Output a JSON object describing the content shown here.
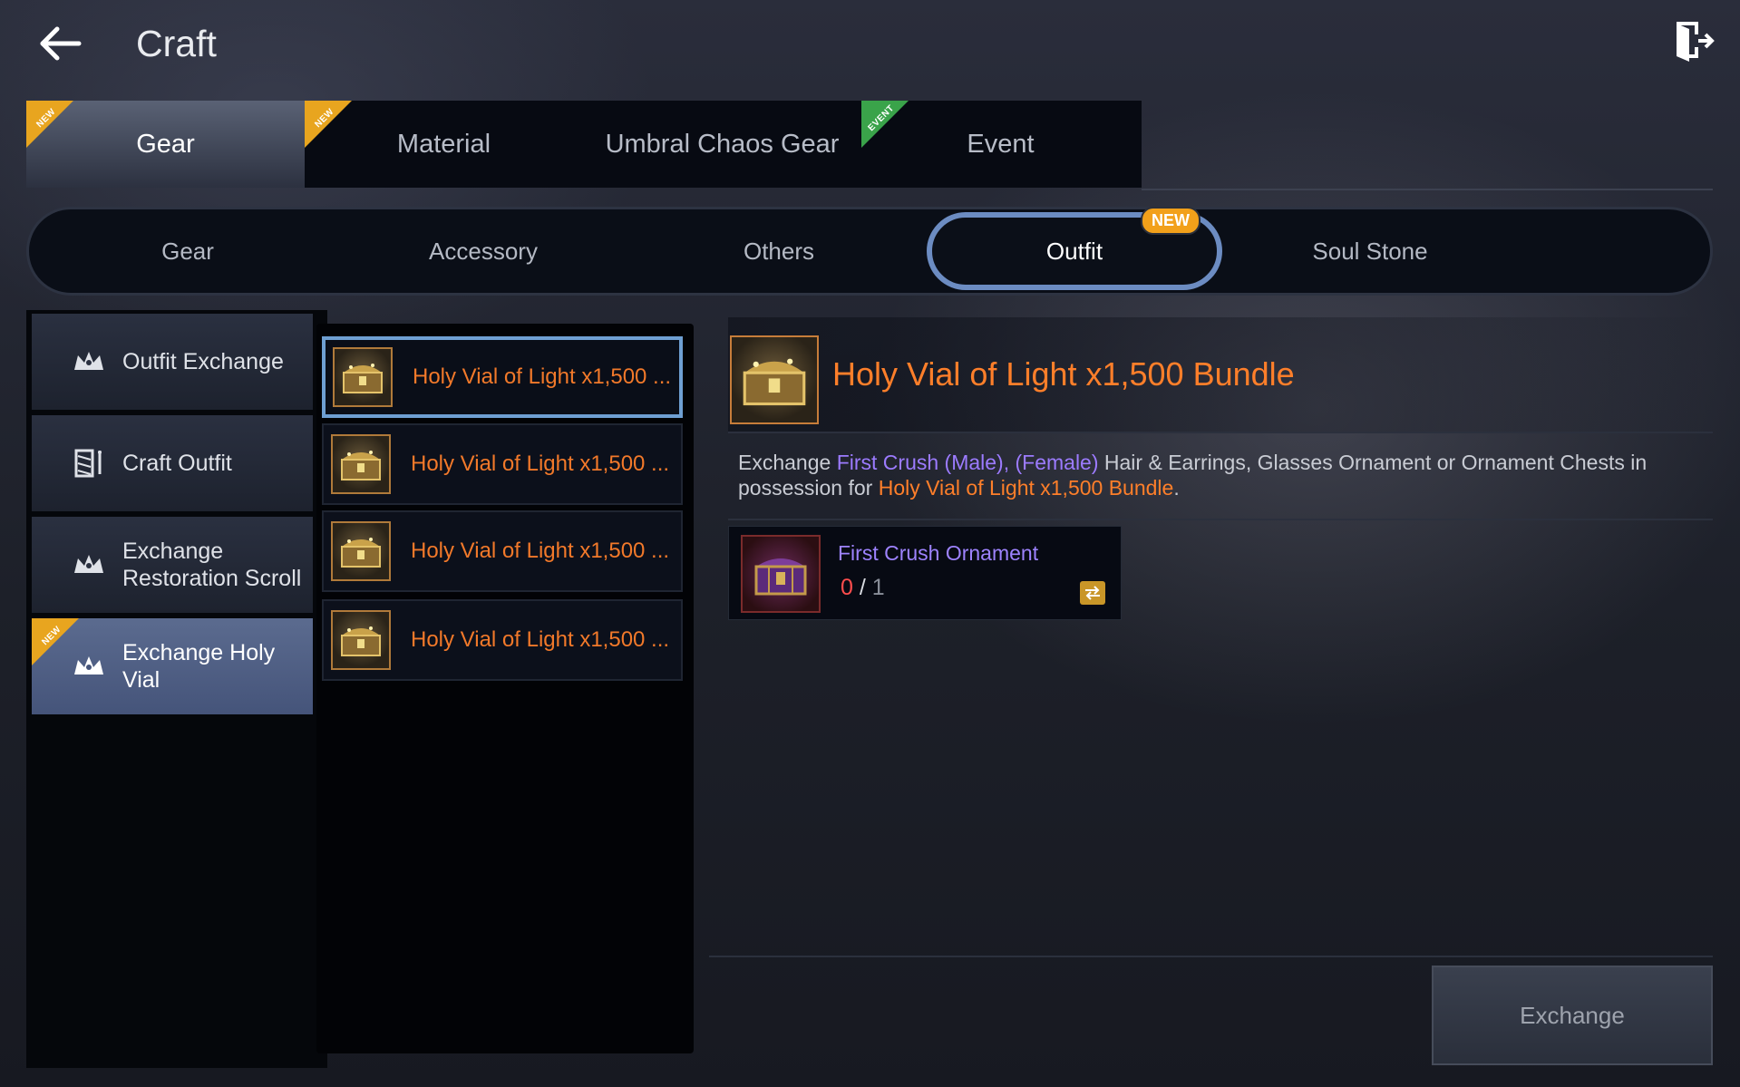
{
  "header": {
    "title": "Craft"
  },
  "top_tabs": [
    {
      "label": "Gear",
      "badge": "NEW"
    },
    {
      "label": "Material",
      "badge": "NEW"
    },
    {
      "label": "Umbral Chaos Gear",
      "badge": ""
    },
    {
      "label": "Event",
      "badge": "EVENT"
    }
  ],
  "sub_tabs": [
    {
      "label": "Gear"
    },
    {
      "label": "Accessory"
    },
    {
      "label": "Others"
    },
    {
      "label": "Outfit",
      "badge": "NEW"
    },
    {
      "label": "Soul Stone"
    }
  ],
  "categories": [
    {
      "label": "Outfit Exchange"
    },
    {
      "label": "Craft Outfit"
    },
    {
      "label": "Exchange Restoration Scroll"
    },
    {
      "label": "Exchange Holy Vial",
      "badge": "NEW"
    }
  ],
  "items": [
    {
      "label": "Holy Vial of Light x1,500 ..."
    },
    {
      "label": "Holy Vial of Light x1,500 ..."
    },
    {
      "label": "Holy Vial of Light x1,500 ..."
    },
    {
      "label": "Holy Vial of Light x1,500 ..."
    }
  ],
  "detail": {
    "title": "Holy Vial of Light x1,500 Bundle",
    "desc": {
      "p1": "Exchange ",
      "p2": "First Crush (Male), (Female)",
      "p3": " Hair & Earrings, Glasses Ornament or Ornament Chests in possession for ",
      "p4": "Holy Vial of Light x1,500 Bundle",
      "p5": "."
    },
    "material": {
      "name": "First Crush Ornament",
      "have": "0",
      "sep": " / ",
      "need": "1"
    },
    "exchange_label": "Exchange"
  },
  "colors": {
    "accent_orange": "#ff7f2a",
    "accent_purple": "#9c7bff",
    "selected_blue": "#6e9fd2",
    "new_badge": "#e8a51f",
    "event_badge": "#3aa34a"
  }
}
